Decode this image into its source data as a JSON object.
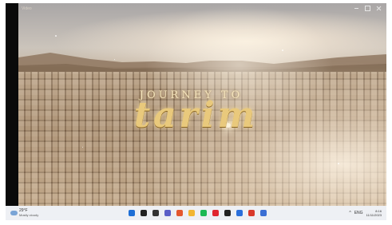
{
  "window": {
    "title": "Video",
    "controls": [
      "minimize-icon",
      "maximize-icon",
      "close-icon"
    ]
  },
  "video": {
    "title_top": "JOURNEY TO",
    "title_main": "tarim"
  },
  "taskbar": {
    "weather": {
      "temp": "29°F",
      "condition": "Mostly cloudy",
      "icon": "cloud-icon"
    },
    "apps": [
      {
        "name": "start-icon",
        "color": "#1f6fd6"
      },
      {
        "name": "search-icon",
        "color": "#222222"
      },
      {
        "name": "task-view-icon",
        "color": "#333333"
      },
      {
        "name": "chat-icon",
        "color": "#5b5fc7"
      },
      {
        "name": "office-icon",
        "color": "#e4572e"
      },
      {
        "name": "file-explorer-icon",
        "color": "#f2b632"
      },
      {
        "name": "spotify-icon",
        "color": "#1db954"
      },
      {
        "name": "opera-icon",
        "color": "#e0262f"
      },
      {
        "name": "media-player-icon",
        "color": "#222222"
      },
      {
        "name": "store-icon",
        "color": "#2a6fdb"
      },
      {
        "name": "chrome-icon",
        "color": "#d93a2c"
      },
      {
        "name": "settings-icon",
        "color": "#3b6fd4"
      }
    ],
    "tray": {
      "chevron": "^",
      "network_label": "ENG",
      "time": "8:16",
      "date": "11/11/2023"
    }
  }
}
